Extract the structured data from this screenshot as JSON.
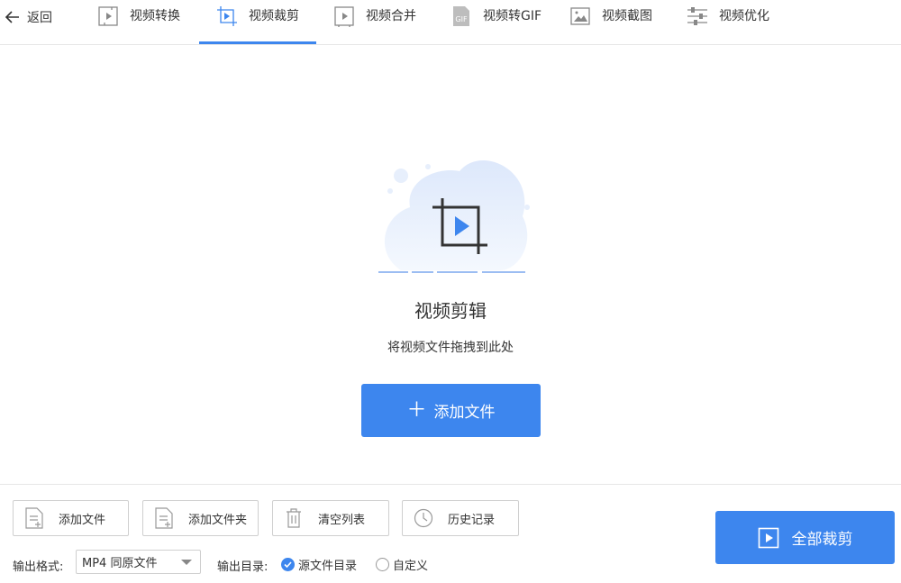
{
  "nav": {
    "back_label": "返回",
    "tabs": [
      {
        "label": "视频转换",
        "icon": "video-convert-icon",
        "active": false
      },
      {
        "label": "视频裁剪",
        "icon": "video-crop-icon",
        "active": true
      },
      {
        "label": "视频合并",
        "icon": "video-merge-icon",
        "active": false
      },
      {
        "label": "视频转GIF",
        "icon": "gif-icon",
        "active": false
      },
      {
        "label": "视频截图",
        "icon": "screenshot-icon",
        "active": false
      },
      {
        "label": "视频优化",
        "icon": "optimize-sliders-icon",
        "active": false
      }
    ],
    "gif_badge": "GIF"
  },
  "hero": {
    "title": "视频剪辑",
    "subtitle": "将视频文件拖拽到此处",
    "add_button_label": "添加文件"
  },
  "toolbar": {
    "add_file_label": "添加文件",
    "add_folder_label": "添加文件夹",
    "clear_list_label": "清空列表",
    "history_label": "历史记录"
  },
  "output": {
    "format_label": "输出格式:",
    "format_value": "MP4 同原文件",
    "dir_label": "输出目录:",
    "dir_options": [
      {
        "label": "源文件目录",
        "selected": true
      },
      {
        "label": "自定义",
        "selected": false
      }
    ]
  },
  "action": {
    "cut_all_label": "全部裁剪"
  },
  "colors": {
    "accent": "#3d86ee",
    "icon_gray": "#888888"
  }
}
